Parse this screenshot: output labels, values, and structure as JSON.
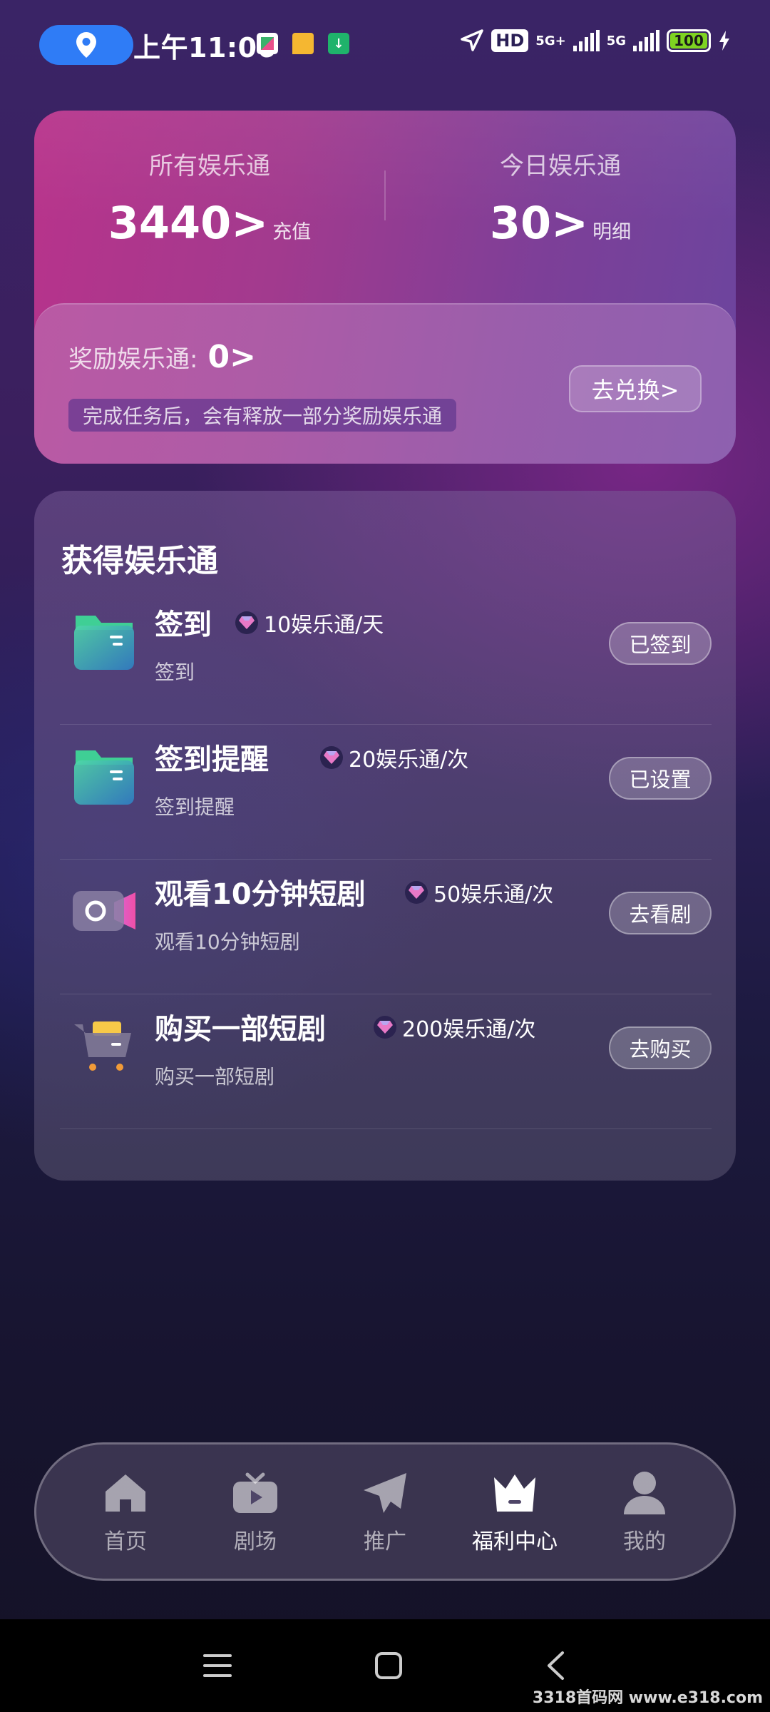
{
  "status_bar": {
    "time": "上午11:06",
    "network_badge": "HD",
    "net1": "5G+",
    "net2": "5G",
    "battery": "100"
  },
  "summary": {
    "all_label": "所有娱乐通",
    "all_value": "3440>",
    "all_link": "充值",
    "today_label": "今日娱乐通",
    "today_value": "30>",
    "today_link": "明细"
  },
  "reward": {
    "label": "奖励娱乐通:",
    "value": "0>",
    "note": "完成任务后，会有释放一部分奖励娱乐通",
    "button": "去兑换>"
  },
  "tasks": {
    "title": "获得娱乐通",
    "items": [
      {
        "name": "签到",
        "reward": "10娱乐通/天",
        "desc": "签到",
        "button": "已签到"
      },
      {
        "name": "签到提醒",
        "reward": "20娱乐通/次",
        "desc": "签到提醒",
        "button": "已设置"
      },
      {
        "name": "观看10分钟短剧",
        "reward": "50娱乐通/次",
        "desc": "观看10分钟短剧",
        "button": "去看剧"
      },
      {
        "name": "购买一部短剧",
        "reward": "200娱乐通/次",
        "desc": "购买一部短剧",
        "button": "去购买"
      }
    ]
  },
  "tabbar": {
    "items": [
      {
        "label": "首页",
        "icon": "home-icon"
      },
      {
        "label": "剧场",
        "icon": "tv-icon"
      },
      {
        "label": "推广",
        "icon": "paper-plane-icon"
      },
      {
        "label": "福利中心",
        "icon": "crown-icon"
      },
      {
        "label": "我的",
        "icon": "user-icon"
      }
    ],
    "active_index": 3
  },
  "watermark": "3318首码网 www.e318.com"
}
